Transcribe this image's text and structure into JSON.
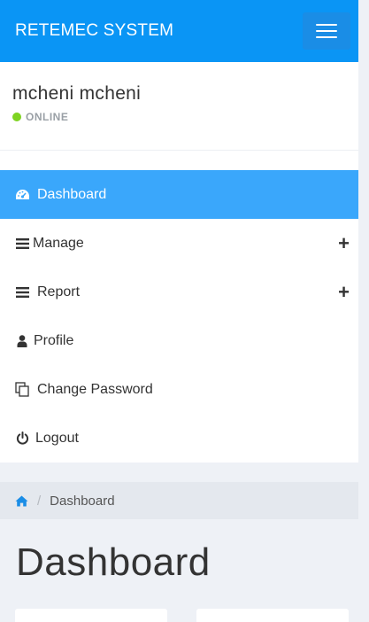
{
  "header": {
    "brand": "RETEMEC SYSTEM",
    "menu_icon": "hamburger-icon"
  },
  "user": {
    "name": "mcheni mcheni",
    "status": "ONLINE",
    "status_color": "#7ed321"
  },
  "nav": {
    "items": [
      {
        "label": "Dashboard",
        "icon": "dashboard-icon",
        "active": true
      },
      {
        "label": "Manage",
        "icon": "bars-icon",
        "expand": "+"
      },
      {
        "label": "Report",
        "icon": "bars-icon",
        "expand": "+"
      },
      {
        "label": "Profile",
        "icon": "user-icon"
      },
      {
        "label": "Change Password",
        "icon": "copy-icon"
      },
      {
        "label": "Logout",
        "icon": "power-icon"
      }
    ]
  },
  "breadcrumb": {
    "home_icon": "home-icon",
    "separator": "/",
    "current": "Dashboard"
  },
  "page": {
    "title": "Dashboard"
  },
  "colors": {
    "primary": "#0a95f5",
    "active_nav": "#3aa7fb"
  }
}
